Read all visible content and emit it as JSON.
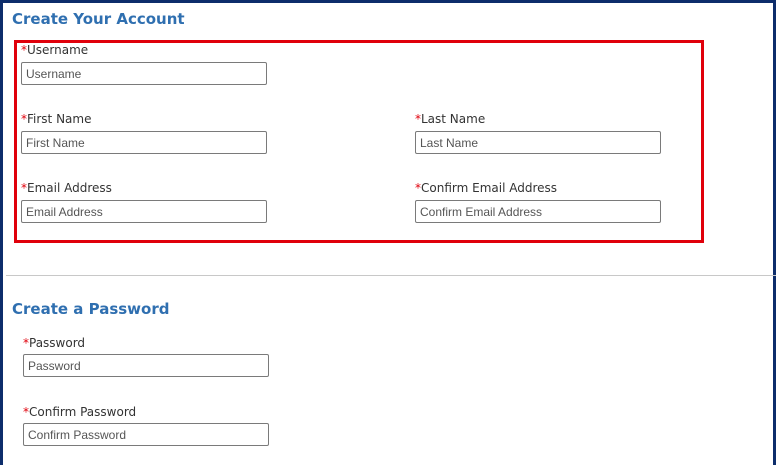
{
  "account_section": {
    "title": "Create Your Account",
    "fields": {
      "username": {
        "required_marker": "*",
        "label": "Username",
        "placeholder": "Username",
        "value": ""
      },
      "first_name": {
        "required_marker": "*",
        "label": "First Name",
        "placeholder": "First Name",
        "value": ""
      },
      "last_name": {
        "required_marker": "*",
        "label": "Last Name",
        "placeholder": "Last Name",
        "value": ""
      },
      "email": {
        "required_marker": "*",
        "label": "Email Address",
        "placeholder": "Email Address",
        "value": ""
      },
      "confirm_email": {
        "required_marker": "*",
        "label": "Confirm Email Address",
        "placeholder": "Confirm Email Address",
        "value": ""
      }
    }
  },
  "password_section": {
    "title": "Create a Password",
    "fields": {
      "password": {
        "required_marker": "*",
        "label": "Password",
        "placeholder": "Password",
        "value": ""
      },
      "confirm_password": {
        "required_marker": "*",
        "label": "Confirm Password",
        "placeholder": "Confirm Password",
        "value": ""
      }
    }
  },
  "colors": {
    "section_title": "#2f6fb0",
    "required_marker": "#e0000b",
    "highlight_border": "#e0000b",
    "frame_border": "#0d2d6b"
  }
}
